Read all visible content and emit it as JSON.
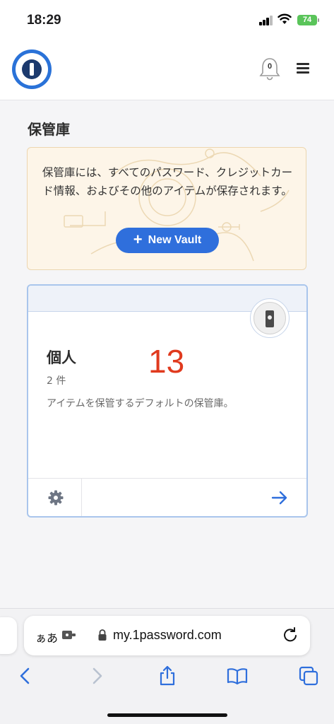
{
  "status_bar": {
    "time": "18:29",
    "battery": "74"
  },
  "header": {
    "notification_count": "0"
  },
  "page": {
    "title": "保管庫"
  },
  "info_card": {
    "text": "保管庫には、すべてのパスワード、クレジットカード情報、およびその他のアイテムが保存されます。",
    "button_label": "New Vault",
    "button_plus": "+"
  },
  "vault": {
    "name": "個人",
    "overlay_number": "13",
    "item_count": "2 件",
    "description": "アイテムを保管するデフォルトの保管庫。"
  },
  "browser": {
    "aa_label": "ぁあ",
    "url": "my.1password.com"
  },
  "colors": {
    "accent": "#2f6fdc",
    "info_bg": "#fdf5e8",
    "vault_border": "#a9c5ec",
    "overlay_number": "#e03a1e",
    "battery": "#5ac45a"
  }
}
